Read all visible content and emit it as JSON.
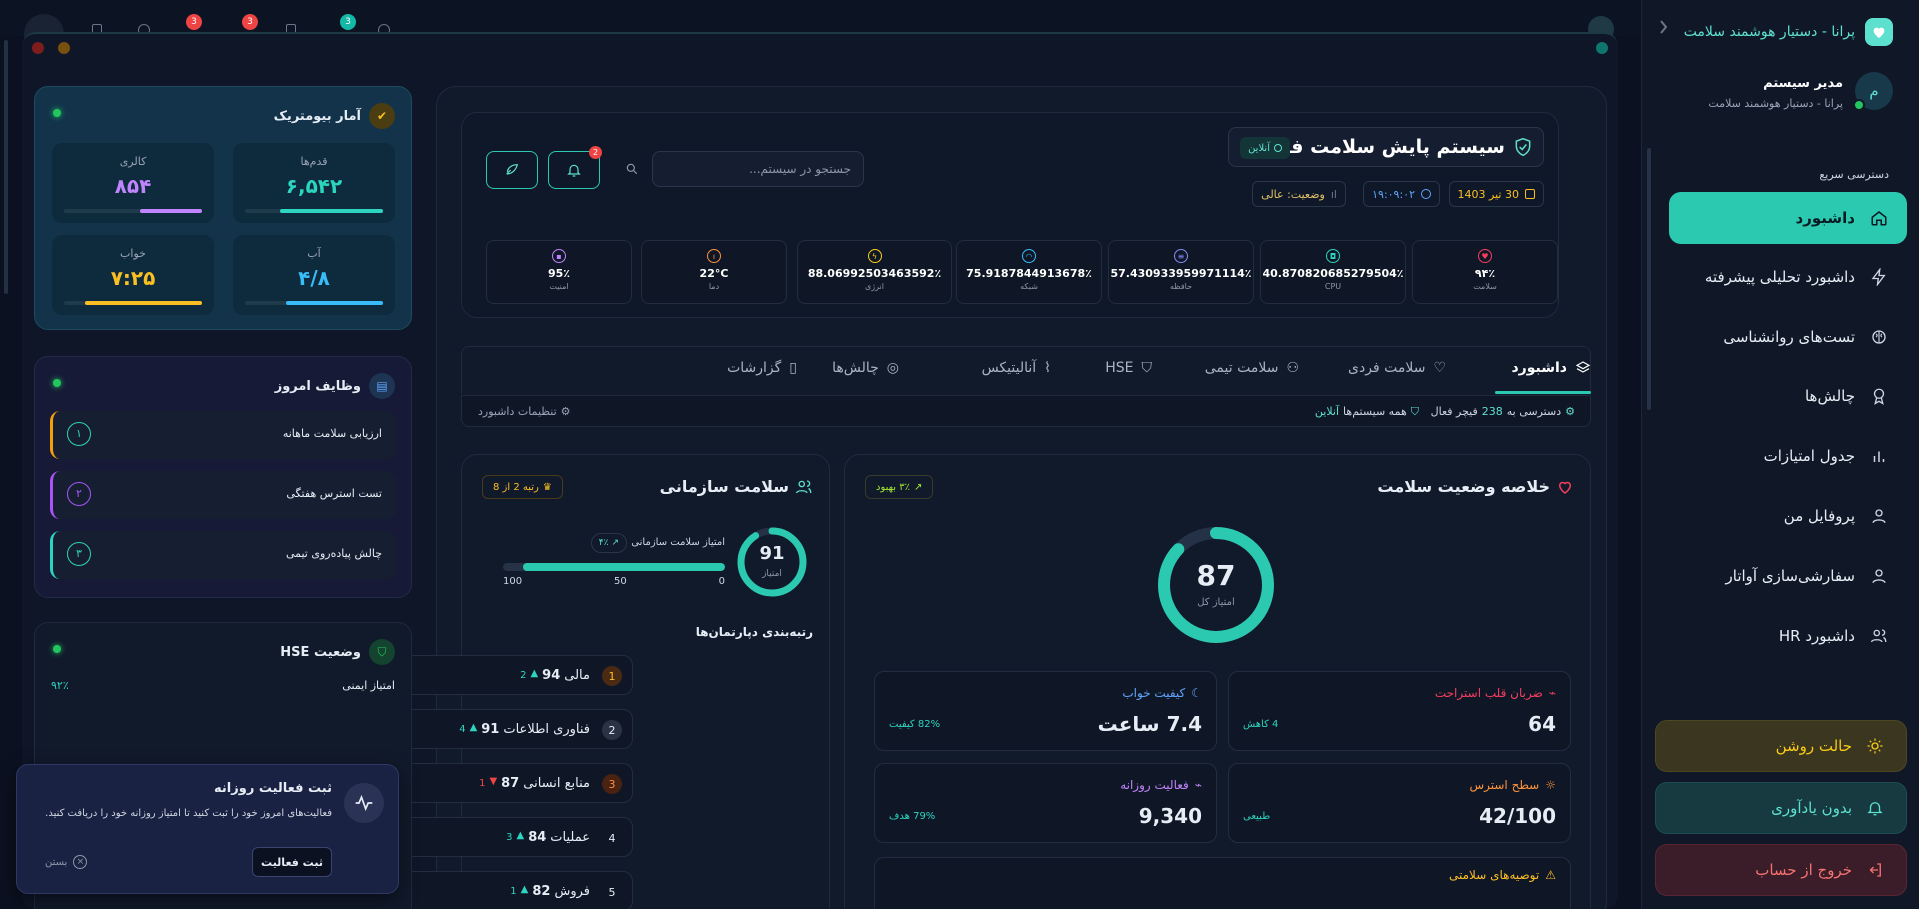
{
  "sidebar": {
    "app_title": "پرانا - دستیار هوشمند سلامت",
    "user": {
      "initial": "م",
      "name": "مدیر سیستم",
      "subtitle": "پرانا - دستیار هوشمند سلامت"
    },
    "quick_access": "دسترسی سریع",
    "items": [
      {
        "label": "داشبورد",
        "icon": "home-icon",
        "active": true
      },
      {
        "label": "داشبورد تحلیلی پیشرفته",
        "icon": "bolt-icon"
      },
      {
        "label": "تست‌های روانشناسی",
        "icon": "brain-icon"
      },
      {
        "label": "چالش‌ها",
        "icon": "award-icon"
      },
      {
        "label": "جدول امتیازات",
        "icon": "bar-chart-icon"
      },
      {
        "label": "پروفایل من",
        "icon": "user-icon"
      },
      {
        "label": "سفارشی‌سازی آواتار",
        "icon": "user-icon"
      },
      {
        "label": "داشبورد HR",
        "icon": "users-icon"
      }
    ],
    "light_mode": "حالت روشن",
    "no_reminder": "بدون یادآوری",
    "logout": "خروج از حساب"
  },
  "topbar": {
    "badges": [
      "3",
      "3",
      "3"
    ]
  },
  "header": {
    "title": "سیستم پایش سلامت فضایی",
    "online": "آنلاین",
    "search_placeholder": "جستجو در سیستم...",
    "notif_count": "2",
    "date": "30 تیر 1403",
    "time": "۱۹:۰۹:۰۲",
    "status": "وضعیت: عالی"
  },
  "kpis": [
    {
      "value": "۹۴٪",
      "label": "سلامت",
      "color": "#f43f5e"
    },
    {
      "value": "40.870820685279504٪",
      "label": "CPU",
      "color": "#2dd4bf"
    },
    {
      "value": "57.430933959971114٪",
      "label": "حافظه",
      "color": "#818cf8"
    },
    {
      "value": "75.9187844913678٪",
      "label": "شبکه",
      "color": "#38bdf8"
    },
    {
      "value": "88.06992503463592٪",
      "label": "انرژی",
      "color": "#facc15"
    },
    {
      "value": "22°C",
      "label": "دما",
      "color": "#fb923c"
    },
    {
      "value": "95٪",
      "label": "امنیت",
      "color": "#c084fc"
    }
  ],
  "tabs": [
    {
      "label": "داشبورد",
      "active": true
    },
    {
      "label": "سلامت فردی"
    },
    {
      "label": "سلامت تیمی"
    },
    {
      "label": "HSE"
    },
    {
      "label": "آنالیتیکس"
    },
    {
      "label": "چالش‌ها"
    },
    {
      "label": "گزارشات"
    }
  ],
  "statusbar": {
    "access_pre": "دسترسی به",
    "access_num": "238",
    "access_post": "فیچر فعال",
    "systems_pre": "همه سیستم‌ها",
    "systems_post": "آنلاین",
    "settings": "تنظیمات داشبورد"
  },
  "health_summary": {
    "title": "خلاصه وضعیت سلامت",
    "improvement": "۳٪ بهبود",
    "score": 87,
    "score_label": "امتیاز کل",
    "metrics": [
      {
        "title": "ضربان قلب استراحت",
        "value": "64",
        "note": "4 کاهش",
        "color": "#f43f5e"
      },
      {
        "title": "کیفیت خواب",
        "value": "7.4 ساعت",
        "note": "82% کیفیت",
        "color": "#60a5fa"
      },
      {
        "title": "سطح استرس",
        "value": "42/100",
        "note": "طبیعی",
        "color": "#fb923c"
      },
      {
        "title": "فعالیت روزانه",
        "value": "9,340",
        "note": "79% هدف",
        "color": "#c084fc"
      }
    ],
    "recommendations_title": "توصیه‌های سلامتی"
  },
  "org_health": {
    "title": "سلامت سازمانی",
    "rank": "رتبه 2 از 8",
    "score": 91,
    "score_label": "امتیاز",
    "bar_label": "امتیاز سلامت سازمانی",
    "bar_trend": "۴٪",
    "bar_ticks": [
      "100",
      "50",
      "0"
    ],
    "dept_title": "رتبه‌بندی دپارتمان‌ها",
    "departments": [
      {
        "rank": "1",
        "name": "مالی",
        "score": "94",
        "delta": "2",
        "up": true
      },
      {
        "rank": "2",
        "name": "فناوری اطلاعات",
        "score": "91",
        "delta": "4",
        "up": true
      },
      {
        "rank": "3",
        "name": "منابع انسانی",
        "score": "87",
        "delta": "1",
        "up": false
      },
      {
        "rank": "4",
        "name": "عملیات",
        "score": "84",
        "delta": "3",
        "up": true
      },
      {
        "rank": "5",
        "name": "فروش",
        "score": "82",
        "delta": "1",
        "up": true
      }
    ]
  },
  "biometric": {
    "title": "آمار بیومتریک",
    "items": [
      {
        "label": "قدم‌ها",
        "value": "۶,۵۴۲",
        "color": "#2dd4bf",
        "level": 0.75
      },
      {
        "label": "کالری",
        "value": "۸۵۴",
        "color": "#c084fc",
        "level": 0.45
      },
      {
        "label": "آب",
        "value": "۴/۸",
        "color": "#38bdf8",
        "level": 0.7
      },
      {
        "label": "خواب",
        "value": "۷:۲۵",
        "color": "#fbbf24",
        "level": 0.85
      }
    ]
  },
  "tasks": {
    "title": "وظایف امروز",
    "items": [
      {
        "label": "ارزیابی سلامت ماهانه",
        "num": "۱",
        "color": "#f59e0b"
      },
      {
        "label": "تست استرس هفتگی",
        "num": "۲",
        "color": "#a855f7"
      },
      {
        "label": "چالش پیاده‌روی تیمی",
        "num": "۳",
        "color": "#2dd4bf"
      }
    ]
  },
  "hse": {
    "title": "وضعیت HSE",
    "score_label": "امتیاز ایمنی",
    "score": "۹۲٪"
  },
  "activity_toast": {
    "title": "ثبت فعالیت روزانه",
    "body": "فعالیت‌های امروز خود را ثبت کنید تا امتیاز روزانه خود را دریافت کنید.",
    "button": "ثبت فعالیت",
    "close": "بستن"
  }
}
